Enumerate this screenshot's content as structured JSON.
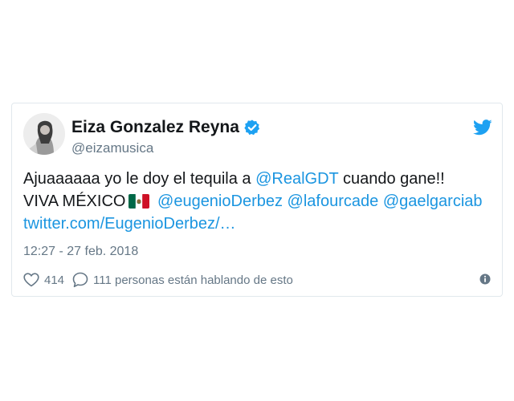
{
  "author": {
    "display_name": "Eiza Gonzalez Reyna",
    "username": "@eizamusica",
    "verified": true
  },
  "tweet": {
    "line1": {
      "text_before": "Ajuaaaaaa yo le doy el tequila a ",
      "mention": "@RealGDT",
      "text_after": " cuando gane!!"
    },
    "line2": {
      "text_before": "VIVA MÉXICO",
      "flag": "mexico-flag-emoji",
      "mention1": "@eugenioDerbez",
      "mention2": "@lafourcade",
      "mention3": "@gaelgarciab"
    },
    "line3": {
      "link": "twitter.com/EugenioDerbez/…"
    }
  },
  "timestamp": "12:27 - 27 feb. 2018",
  "actions": {
    "likes": "414",
    "replies_text": "111 personas están hablando de esto"
  },
  "colors": {
    "link": "#1b95e0",
    "secondary_text": "#657786",
    "primary_text": "#14171a",
    "border": "#e1e8ed"
  }
}
